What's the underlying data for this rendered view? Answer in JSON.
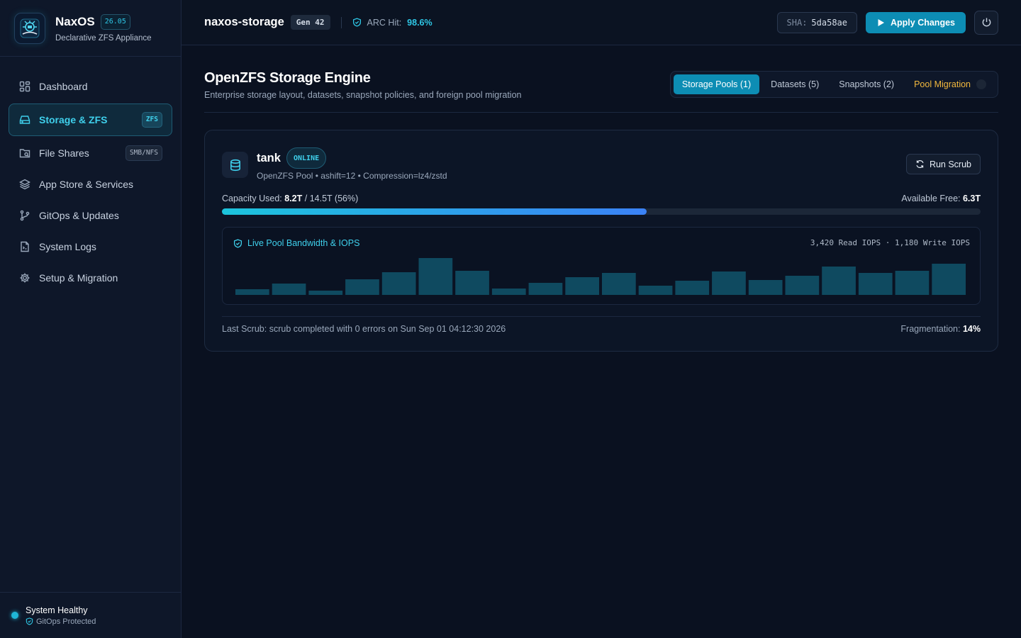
{
  "brand": {
    "name": "NaxOS",
    "version": "26.05",
    "subtitle": "Declarative ZFS Appliance"
  },
  "sidebar": {
    "items": [
      {
        "label": "Dashboard",
        "icon": "dashboard-icon",
        "active": false
      },
      {
        "label": "Storage & ZFS",
        "icon": "hard-drive-icon",
        "active": true,
        "tag": "ZFS"
      },
      {
        "label": "File Shares",
        "icon": "folder-share-icon",
        "active": false,
        "tag": "SMB/NFS"
      },
      {
        "label": "App Store & Services",
        "icon": "layers-icon",
        "active": false
      },
      {
        "label": "GitOps & Updates",
        "icon": "git-branch-icon",
        "active": false
      },
      {
        "label": "System Logs",
        "icon": "log-file-icon",
        "active": false
      },
      {
        "label": "Setup & Migration",
        "icon": "gear-icon",
        "active": false
      }
    ],
    "status": {
      "main": "System Healthy",
      "sub": "GitOps Protected"
    }
  },
  "topbar": {
    "hostname": "naxos-storage",
    "generation": "Gen 42",
    "arc_label": "ARC Hit:",
    "arc_value": "98.6%",
    "sha_label": "SHA:",
    "sha_value": "5da58ae",
    "apply_label": "Apply Changes"
  },
  "page": {
    "title": "OpenZFS Storage Engine",
    "subtitle": "Enterprise storage layout, datasets, snapshot policies, and foreign pool migration",
    "tabs": [
      {
        "label": "Storage Pools (1)",
        "active": true
      },
      {
        "label": "Datasets (5)",
        "active": false
      },
      {
        "label": "Snapshots (2)",
        "active": false
      },
      {
        "label": "Pool Migration",
        "active": false
      }
    ]
  },
  "pool": {
    "name": "tank",
    "state": "ONLINE",
    "meta": "OpenZFS Pool • ashift=12 • Compression=lz4/zstd",
    "scrub_label": "Run Scrub",
    "capacity_label": "Capacity Used:",
    "capacity_used": "8.2T",
    "capacity_rest": "/ 14.5T (56%)",
    "capacity_fraction": 0.56,
    "available_label": "Available Free:",
    "available_value": "6.3T",
    "bandwidth_title": "Live Pool Bandwidth & IOPS",
    "iops_text": "3,420 Read IOPS · 1,180 Write IOPS",
    "last_scrub": "Last Scrub: scrub completed with 0 errors on Sun Sep 01 04:12:30 2026",
    "frag_label": "Fragmentation:",
    "frag_value": "14%"
  },
  "chart_data": {
    "type": "bar",
    "title": "Live Pool Bandwidth & IOPS",
    "values": [
      8,
      16,
      6,
      22,
      32,
      52,
      34,
      9,
      17,
      25,
      31,
      13,
      20,
      33,
      21,
      27,
      40,
      31,
      34,
      44
    ],
    "ylim": [
      0,
      55
    ],
    "grid": false,
    "color": "#0f4a60"
  },
  "colors": {
    "accent": "#0d8db4",
    "accent_text": "#2ec7e6",
    "warning": "#f3b93e",
    "background": "#0a1120"
  }
}
